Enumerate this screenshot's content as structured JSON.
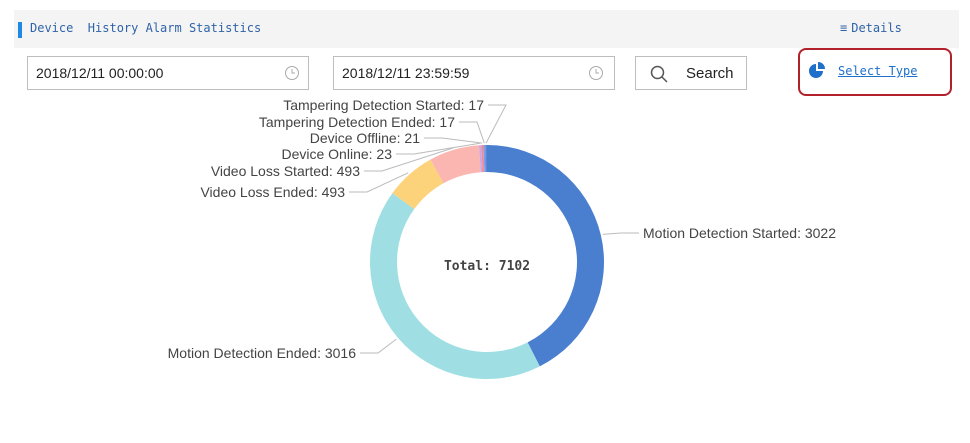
{
  "header": {
    "title": "Device  History Alarm Statistics",
    "details_label": "Details",
    "details_icon": "list-icon"
  },
  "filters": {
    "start_time": "2018/12/11 00:00:00",
    "end_time": "2018/12/11 23:59:59",
    "search_label": "Search",
    "select_type_label": "Select Type"
  },
  "colors": {
    "accent": "#2f63a8",
    "highlight_border": "#b2202a"
  },
  "chart_data": {
    "type": "pie",
    "style": "donut",
    "center_text": "Total: 7102",
    "total": 7102,
    "slices": [
      {
        "name": "Motion Detection Started",
        "value": 3022,
        "label": "Motion Detection Started: 3022",
        "color": "#4a7fd0"
      },
      {
        "name": "Motion Detection Ended",
        "value": 3016,
        "label": "Motion Detection Ended: 3016",
        "color": "#9fdfe3"
      },
      {
        "name": "Video Loss Ended",
        "value": 493,
        "label": "Video Loss Ended: 493",
        "color": "#fcd27a"
      },
      {
        "name": "Video Loss Started",
        "value": 493,
        "label": "Video Loss Started: 493",
        "color": "#fbb6b2"
      },
      {
        "name": "Device Online",
        "value": 23,
        "label": "Device Online: 23",
        "color": "#c9a7e8"
      },
      {
        "name": "Device Offline",
        "value": 21,
        "label": "Device Offline: 21",
        "color": "#f48a8a"
      },
      {
        "name": "Tampering Detection Ended",
        "value": 17,
        "label": "Tampering Detection Ended: 17",
        "color": "#7aa0f0"
      },
      {
        "name": "Tampering Detection Started",
        "value": 17,
        "label": "Tampering Detection Started: 17",
        "color": "#5b86d9"
      }
    ]
  }
}
